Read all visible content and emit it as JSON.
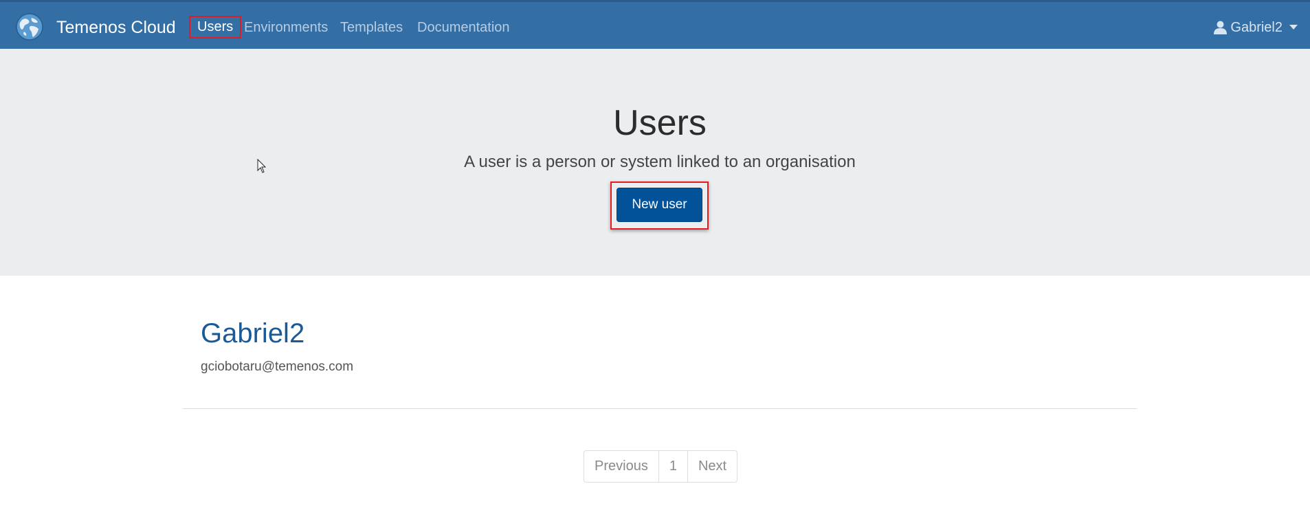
{
  "navbar": {
    "brand": "Temenos Cloud",
    "links": [
      {
        "label": "Users",
        "active": true
      },
      {
        "label": "Environments",
        "active": false
      },
      {
        "label": "Templates",
        "active": false
      },
      {
        "label": "Documentation",
        "active": false
      }
    ],
    "user_menu": {
      "label": "Gabriel2",
      "icon": "user-icon"
    }
  },
  "hero": {
    "title": "Users",
    "subtitle": "A user is a person or system linked to an organisation",
    "new_user_label": "New user"
  },
  "users": [
    {
      "name": "Gabriel2",
      "email": "gciobotaru@temenos.com"
    }
  ],
  "pagination": {
    "previous": "Previous",
    "page": "1",
    "next": "Next"
  },
  "colors": {
    "navbar_bg": "#336ea5",
    "hero_bg": "#ecedef",
    "primary_button": "#02529a",
    "highlight": "#e31b23",
    "user_name": "#1a5a99"
  }
}
